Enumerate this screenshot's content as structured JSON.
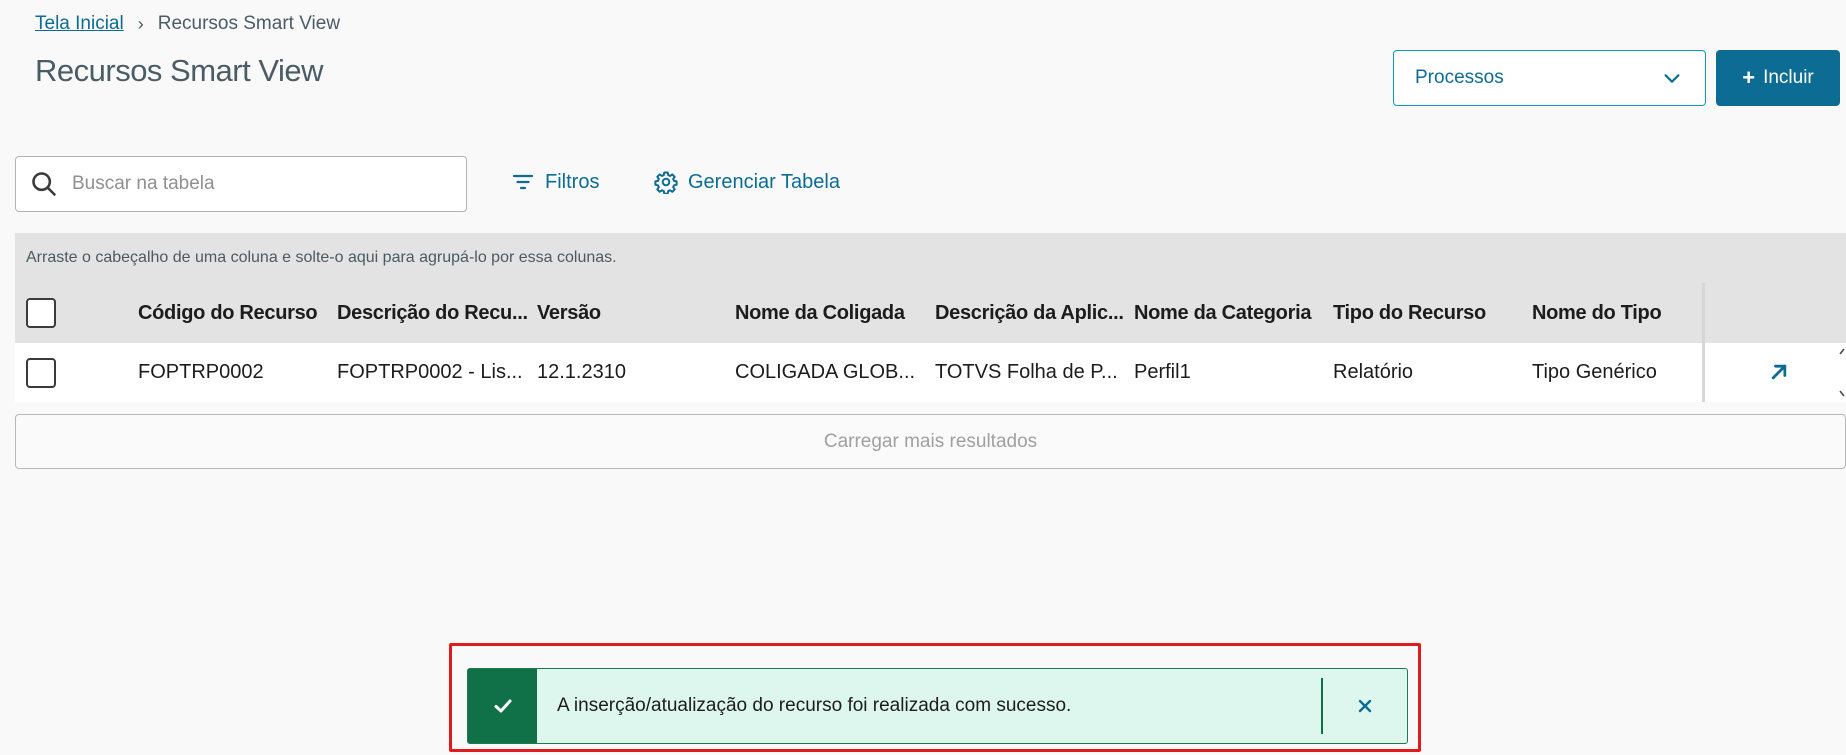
{
  "breadcrumb": {
    "home": "Tela Inicial",
    "separator": "›",
    "current": "Recursos Smart View"
  },
  "page_title": "Recursos Smart View",
  "header_actions": {
    "select_value": "Processos",
    "add_button": "Incluir",
    "add_icon": "+"
  },
  "toolbar": {
    "search_placeholder": "Buscar na tabela",
    "filters_label": "Filtros",
    "manage_table_label": "Gerenciar Tabela"
  },
  "table": {
    "group_hint": "Arraste o cabeçalho de uma coluna e solte-o aqui para agrupá-lo por essa colunas.",
    "columns": [
      "Código do Recurso",
      "Descrição do Recu...",
      "Versão",
      "Nome da Coligada",
      "Descrição da Aplic...",
      "Nome da Categoria",
      "Tipo do Recurso",
      "Nome do Tipo"
    ],
    "rows": [
      {
        "cells": [
          "FOPTRP0002",
          "FOPTRP0002 - Lis...",
          "12.1.2310",
          "COLIGADA GLOB...",
          "TOTVS Folha de P...",
          "Perfil1",
          "Relatório",
          "Tipo Genérico"
        ]
      }
    ],
    "load_more": "Carregar mais resultados"
  },
  "toast": {
    "message": "A inserção/atualização do recurso foi realizada com sucesso.",
    "type": "success"
  },
  "colors": {
    "primary": "#0c6c94",
    "success": "#107048",
    "success_bg": "#def7ee",
    "highlight": "#e01b1b"
  }
}
